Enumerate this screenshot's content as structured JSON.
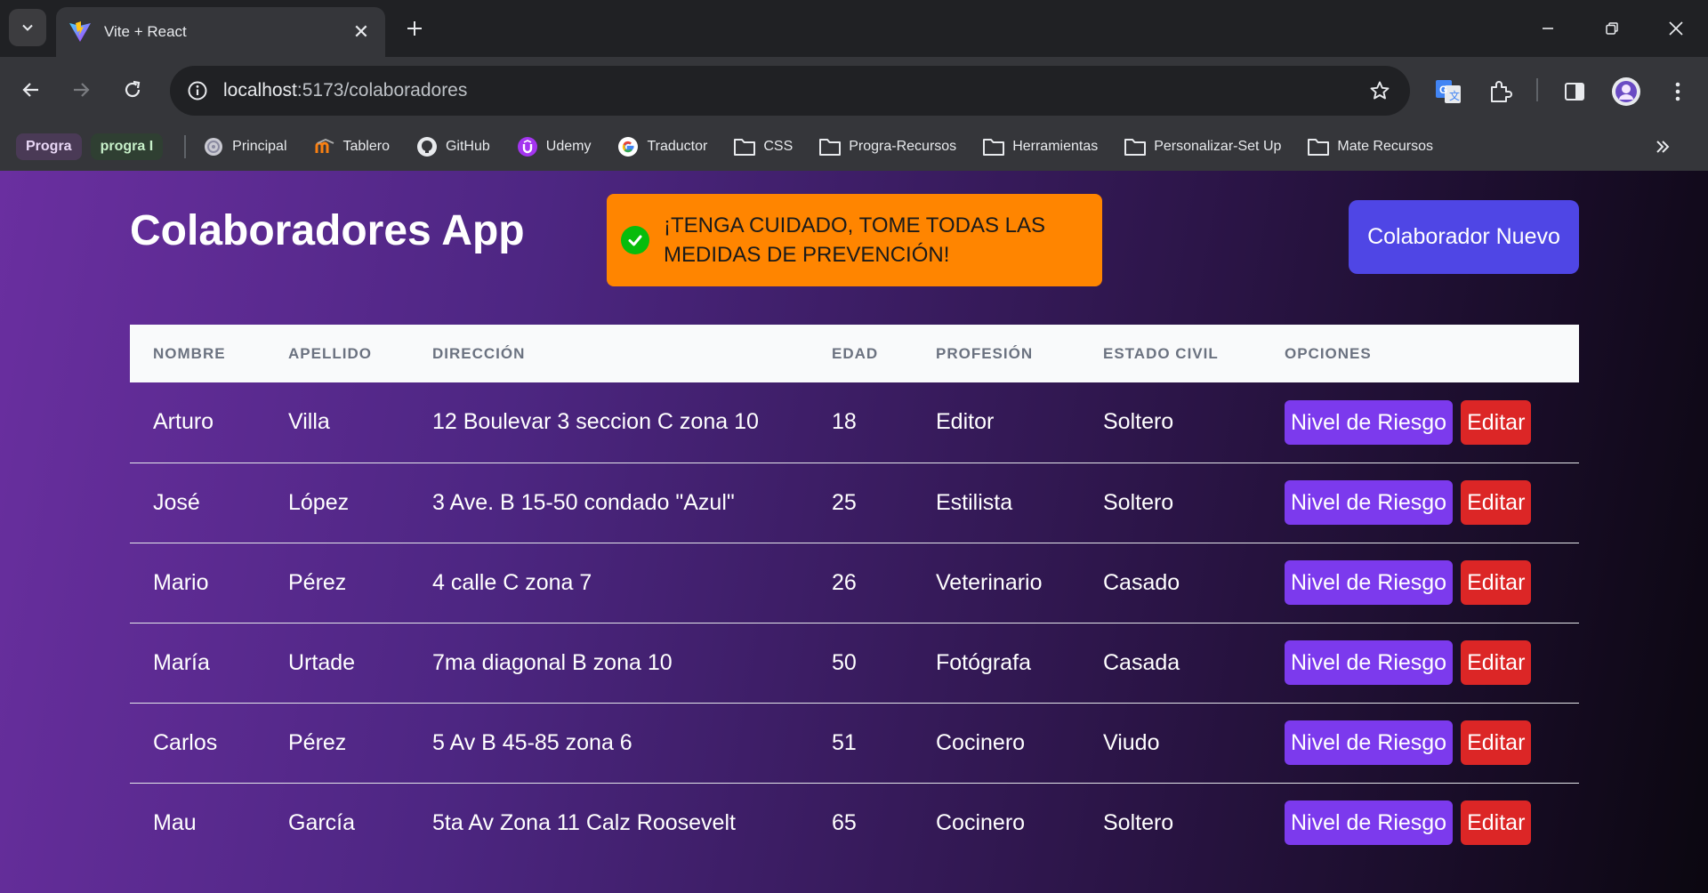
{
  "browser": {
    "tab_title": "Vite + React",
    "url_host": "localhost",
    "url_rest": ":5173/colaboradores",
    "bookmark_groups": [
      {
        "label": "Progra",
        "bg": "#4a3a56",
        "color": "#e8d7f5"
      },
      {
        "label": "progra I",
        "bg": "#2f3f32",
        "color": "#c7f0c9"
      }
    ],
    "bookmarks": [
      {
        "label": "Principal",
        "icon": "globe-icon"
      },
      {
        "label": "Tablero",
        "icon": "moodle-icon"
      },
      {
        "label": "GitHub",
        "icon": "github-icon"
      },
      {
        "label": "Udemy",
        "icon": "udemy-icon"
      },
      {
        "label": "Traductor",
        "icon": "google-icon"
      },
      {
        "label": "CSS",
        "icon": "folder-icon"
      },
      {
        "label": "Progra-Recursos",
        "icon": "folder-icon"
      },
      {
        "label": "Herramientas",
        "icon": "folder-icon"
      },
      {
        "label": "Personalizar-Set Up",
        "icon": "folder-icon"
      },
      {
        "label": "Mate Recursos",
        "icon": "folder-icon"
      }
    ]
  },
  "app": {
    "title": "Colaboradores App",
    "toast_message": "¡TENGA CUIDADO, TOME TODAS LAS MEDIDAS DE PREVENCIÓN!",
    "new_button": "Colaborador Nuevo"
  },
  "table": {
    "headers": [
      "NOMBRE",
      "APELLIDO",
      "DIRECCIÓN",
      "EDAD",
      "PROFESIÓN",
      "ESTADO CIVIL",
      "OPCIONES"
    ],
    "rows": [
      {
        "nombre": "Arturo",
        "apellido": "Villa",
        "direccion": "12 Boulevar 3 seccion C zona 10",
        "edad": "18",
        "profesion": "Editor",
        "estado": "Soltero"
      },
      {
        "nombre": "José",
        "apellido": "López",
        "direccion": "3 Ave. B 15-50 condado \"Azul\"",
        "edad": "25",
        "profesion": "Estilista",
        "estado": "Soltero"
      },
      {
        "nombre": "Mario",
        "apellido": "Pérez",
        "direccion": "4 calle C zona 7",
        "edad": "26",
        "profesion": "Veterinario",
        "estado": "Casado"
      },
      {
        "nombre": "María",
        "apellido": "Urtade",
        "direccion": "7ma diagonal B zona 10",
        "edad": "50",
        "profesion": "Fotógrafa",
        "estado": "Casada"
      },
      {
        "nombre": "Carlos",
        "apellido": "Pérez",
        "direccion": "5 Av B 45-85 zona 6",
        "edad": "51",
        "profesion": "Cocinero",
        "estado": "Viudo"
      },
      {
        "nombre": "Mau",
        "apellido": "García",
        "direccion": "5ta Av Zona 11 Calz Roosevelt",
        "edad": "65",
        "profesion": "Cocinero",
        "estado": "Soltero"
      }
    ],
    "risk_button": "Nivel de Riesgo",
    "edit_button": "Editar"
  },
  "colors": {
    "toast": "#ff8500",
    "primary_button": "#4f46e5",
    "risk_button": "#7c3aed",
    "edit_button": "#dc2626"
  }
}
